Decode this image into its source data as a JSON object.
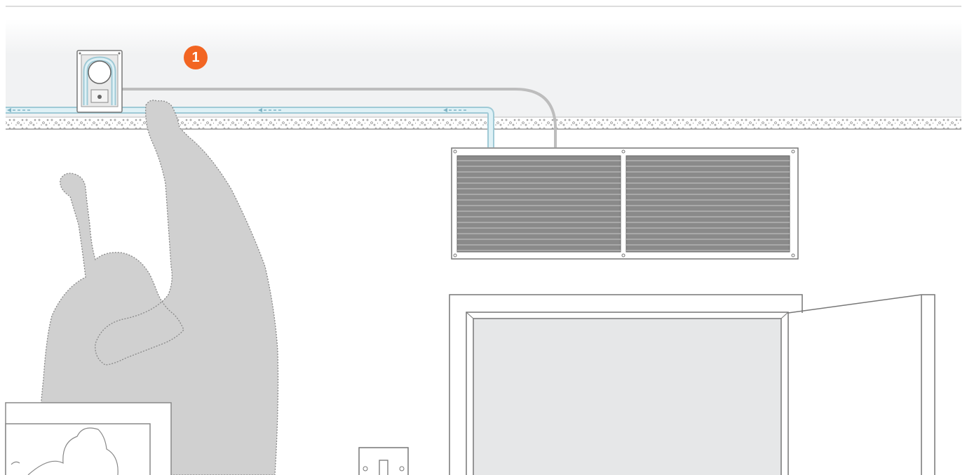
{
  "diagram": {
    "step_number": "1",
    "colors": {
      "accent": "#F26522",
      "ceiling": "#F1F2F3",
      "figure": "#D0D0D0",
      "pipe": "#B8DCE6",
      "cable": "#BDBDBD",
      "grille": "#8A8A8A",
      "concrete": "#9A9A9A"
    },
    "icons": [
      "pump-icon",
      "flow-arrow-icon",
      "person-icon",
      "air-vent-icon",
      "door-icon",
      "light-switch-icon",
      "picture-frame-icon"
    ]
  }
}
